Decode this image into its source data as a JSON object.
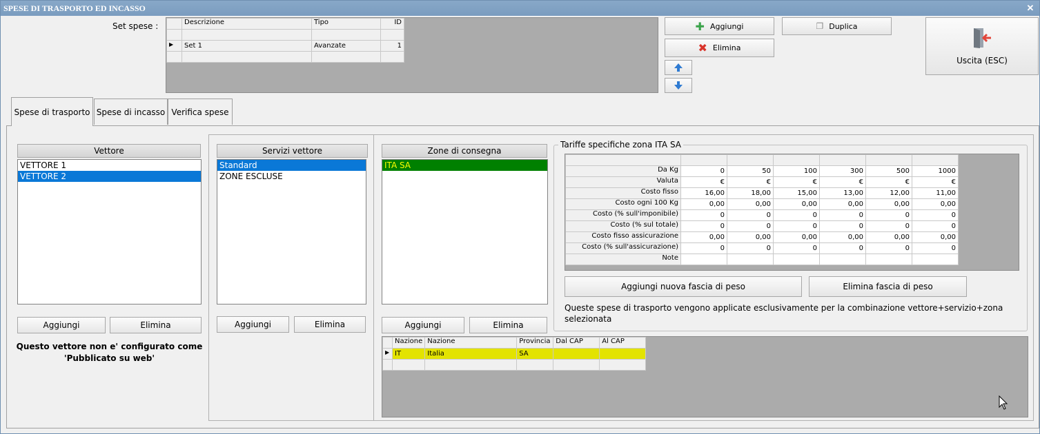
{
  "window": {
    "title": "SPESE DI TRASPORTO ED INCASSO",
    "close": "✕"
  },
  "set_spese": {
    "label": "Set spese :",
    "columns": [
      "Descrizione",
      "Tipo",
      "ID"
    ],
    "rows": [
      {
        "descrizione": "Set 1",
        "tipo": "Avanzate",
        "id": "1"
      }
    ]
  },
  "toolbar": {
    "aggiungi": "Aggiungi",
    "duplica": "Duplica",
    "elimina": "Elimina",
    "exit": "Uscita (ESC)"
  },
  "tabs": [
    "Spese di trasporto",
    "Spese di incasso",
    "Verifica spese"
  ],
  "vettore": {
    "header": "Vettore",
    "items": [
      "VETTORE 1",
      "VETTORE 2"
    ],
    "selected": 1,
    "aggiungi": "Aggiungi",
    "elimina": "Elimina",
    "warning_line1": "Questo vettore non e' configurato come",
    "warning_line2": "'Pubblicato su web'"
  },
  "servizi": {
    "header": "Servizi vettore",
    "items": [
      "Standard",
      "ZONE ESCLUSE"
    ],
    "selected": 0,
    "aggiungi": "Aggiungi",
    "elimina": "Elimina"
  },
  "zone": {
    "header": "Zone di consegna",
    "items": [
      "ITA SA"
    ],
    "selected": 0,
    "aggiungi": "Aggiungi",
    "elimina": "Elimina",
    "columns": [
      "Nazione",
      "Nazione",
      "Provincia",
      "Dal CAP",
      "Al CAP"
    ],
    "rows": [
      {
        "nazione_code": "IT",
        "nazione": "Italia",
        "provincia": "SA",
        "dal": "",
        "al": ""
      }
    ]
  },
  "tariffe": {
    "title": "Tariffe specifiche zona ITA SA",
    "rows": [
      {
        "label": "Da Kg",
        "values": [
          "0",
          "50",
          "100",
          "300",
          "500",
          "1000"
        ]
      },
      {
        "label": "Valuta",
        "values": [
          "€",
          "€",
          "€",
          "€",
          "€",
          "€"
        ]
      },
      {
        "label": "Costo fisso",
        "values": [
          "16,00",
          "18,00",
          "15,00",
          "13,00",
          "12,00",
          "11,00"
        ]
      },
      {
        "label": "Costo ogni 100 Kg",
        "values": [
          "0,00",
          "0,00",
          "0,00",
          "0,00",
          "0,00",
          "0,00"
        ]
      },
      {
        "label": "Costo (% sull'imponibile)",
        "values": [
          "0",
          "0",
          "0",
          "0",
          "0",
          "0"
        ]
      },
      {
        "label": "Costo (% sul totale)",
        "values": [
          "0",
          "0",
          "0",
          "0",
          "0",
          "0"
        ]
      },
      {
        "label": "Costo fisso assicurazione",
        "values": [
          "0,00",
          "0,00",
          "0,00",
          "0,00",
          "0,00",
          "0,00"
        ]
      },
      {
        "label": "Costo (% sull'assicurazione)",
        "values": [
          "0",
          "0",
          "0",
          "0",
          "0",
          "0"
        ]
      },
      {
        "label": "Note",
        "values": [
          "",
          "",
          "",
          "",
          "",
          ""
        ]
      }
    ],
    "aggiungi_fascia": "Aggiungi nuova fascia di peso",
    "elimina_fascia": "Elimina fascia di peso",
    "info": "Queste spese di trasporto vengono applicate esclusivamente per la combinazione vettore+servizio+zona selezionata"
  },
  "colors": {
    "selection": "#0a78d7",
    "zone_selection": "#008000",
    "zone_text": "#ffff00",
    "row_highlight": "#e3e300"
  }
}
